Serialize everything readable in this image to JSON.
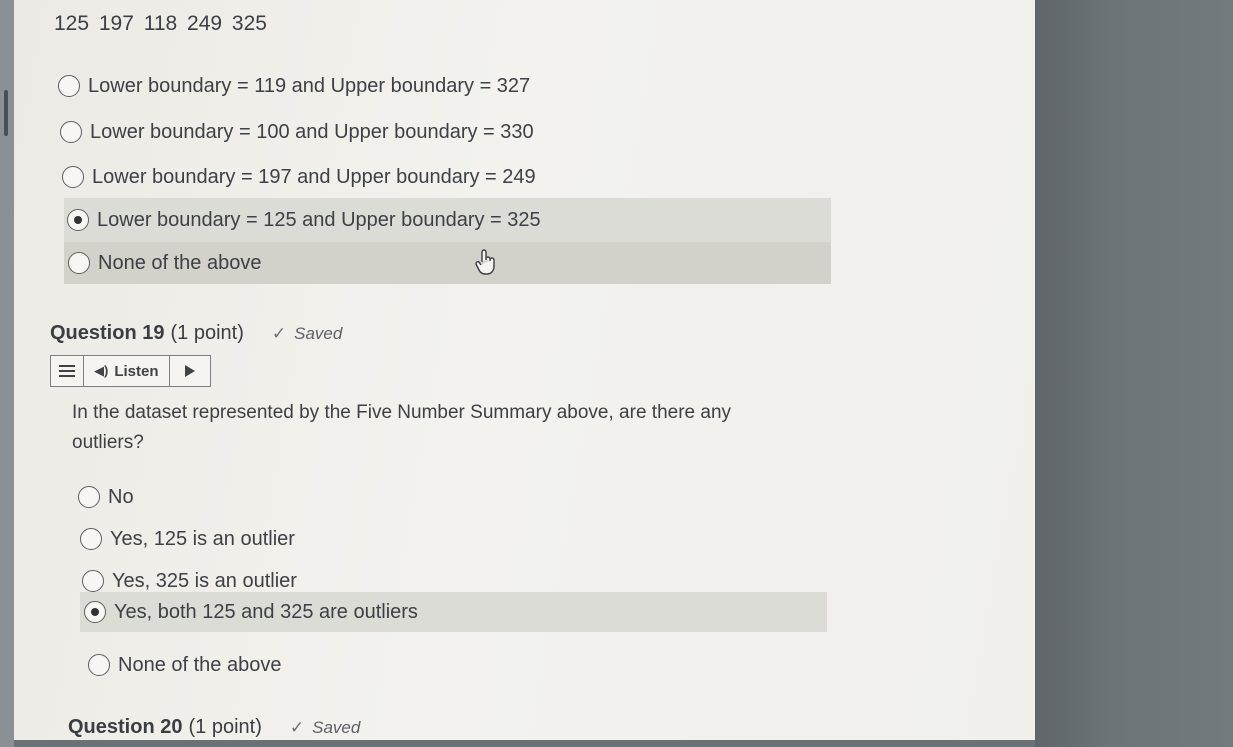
{
  "five_number_summary": "125 197 118 249 325",
  "question18": {
    "options": [
      {
        "label": "Lower boundary = 119 and Upper boundary = 327",
        "selected": false
      },
      {
        "label": "Lower boundary = 100 and Upper boundary = 330",
        "selected": false
      },
      {
        "label": "Lower boundary = 197 and Upper boundary = 249",
        "selected": false
      },
      {
        "label": "Lower boundary = 125 and Upper boundary = 325",
        "selected": true
      },
      {
        "label": "None of the above",
        "selected": false
      }
    ]
  },
  "question19": {
    "title": "Question 19",
    "points": "(1 point)",
    "saved": "Saved",
    "listen_label": "Listen",
    "text": "In the dataset represented by the Five Number Summary above, are there any outliers?",
    "options": [
      {
        "label": "No",
        "selected": false
      },
      {
        "label": "Yes, 125 is an outlier",
        "selected": false
      },
      {
        "label": "Yes, 325 is an outlier",
        "selected": false
      },
      {
        "label": "Yes, both 125 and 325 are outliers",
        "selected": true
      },
      {
        "label": "None of the above",
        "selected": false
      }
    ]
  },
  "question20": {
    "title": "Question 20",
    "points": "(1 point)",
    "saved": "Saved"
  },
  "icons": {
    "saved": "check-icon",
    "menu": "menu-icon",
    "listen": "speaker-icon",
    "play": "play-icon",
    "cursor": "hand-pointer-icon"
  },
  "colors": {
    "page_background": "#f1f0ec",
    "selected_highlight": "#dcdcd6",
    "hover_highlight": "#d2d1ca",
    "text": "#3a3d42"
  }
}
